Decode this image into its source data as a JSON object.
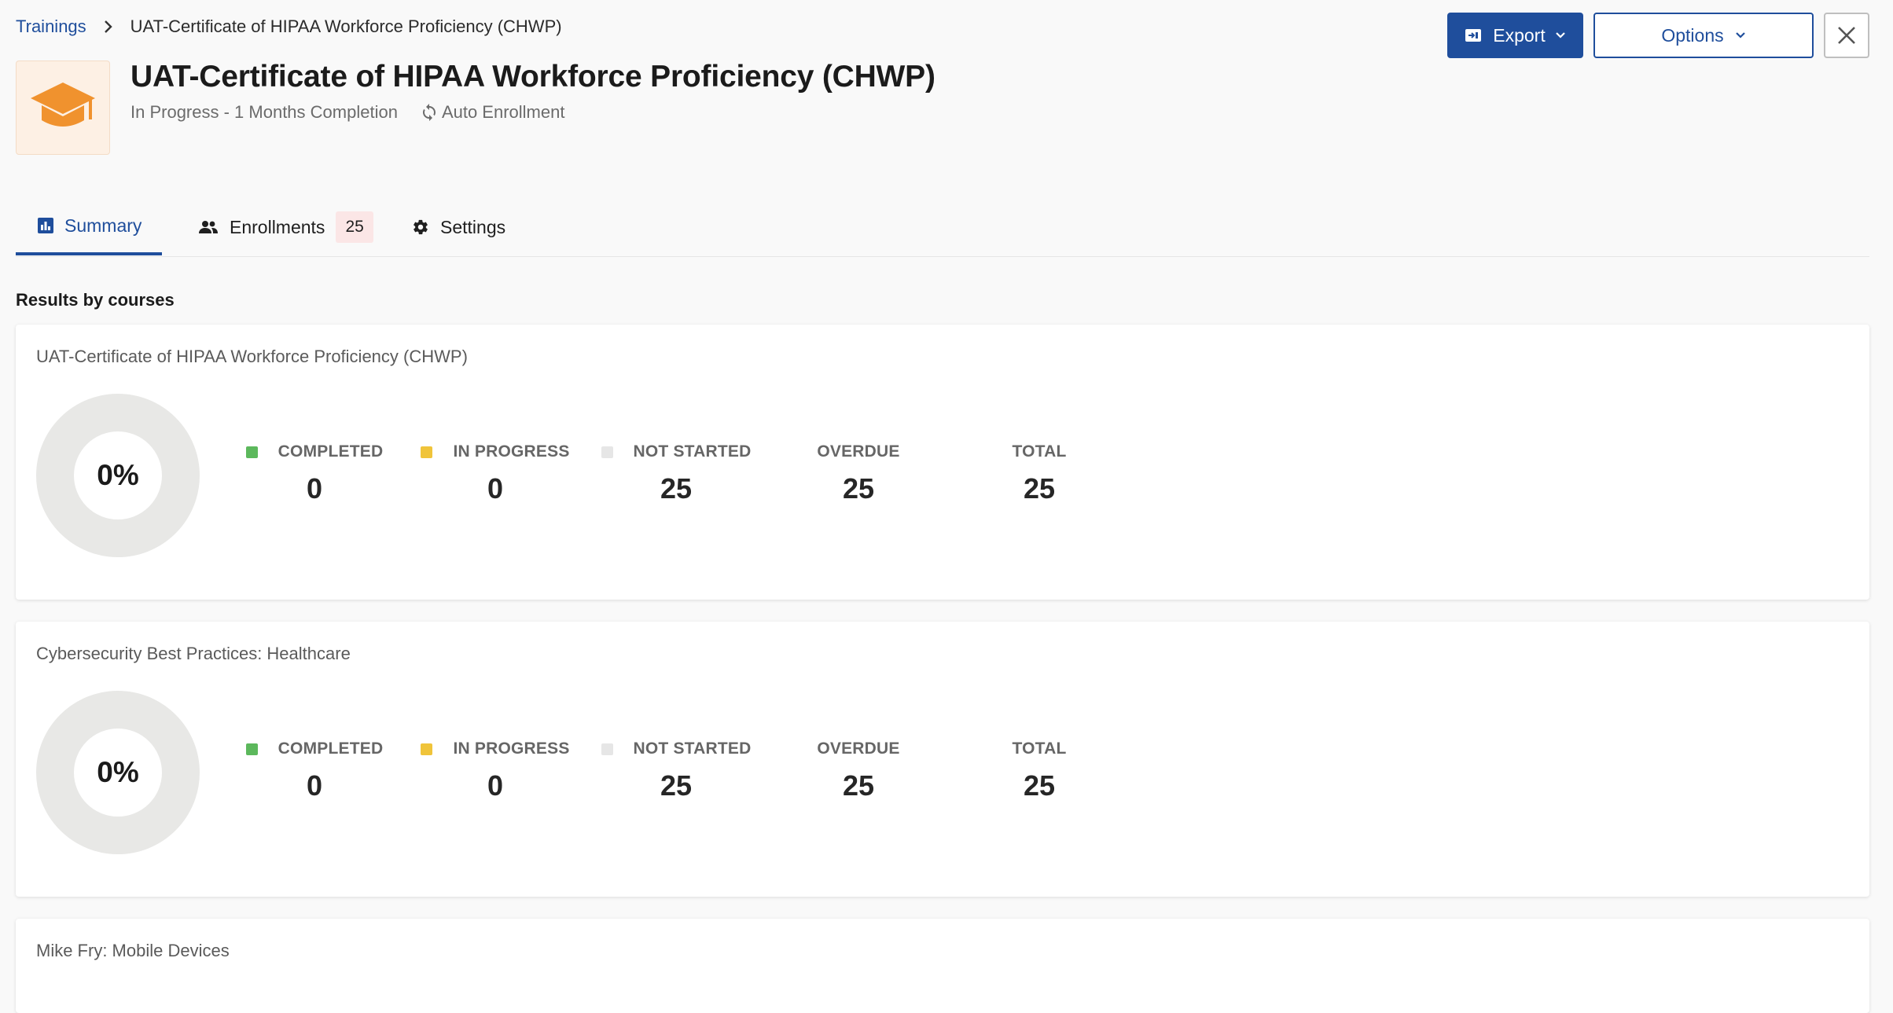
{
  "breadcrumb": {
    "parent": "Trainings",
    "current": "UAT-Certificate of HIPAA Workforce Proficiency (CHWP)"
  },
  "header": {
    "title": "UAT-Certificate of HIPAA Workforce Proficiency (CHWP)",
    "status": "In Progress - 1 Months Completion",
    "auto_enrollment": "Auto Enrollment",
    "icon": "graduation-cap-icon"
  },
  "actions": {
    "export_label": "Export",
    "options_label": "Options"
  },
  "tabs": [
    {
      "label": "Summary",
      "icon": "bar-chart-icon",
      "active": true
    },
    {
      "label": "Enrollments",
      "icon": "people-icon",
      "badge": "25"
    },
    {
      "label": "Settings",
      "icon": "gear-icon"
    }
  ],
  "section_title": "Results by courses",
  "stat_labels": {
    "completed": "COMPLETED",
    "in_progress": "IN PROGRESS",
    "not_started": "NOT STARTED",
    "overdue": "OVERDUE",
    "total": "TOTAL"
  },
  "courses": [
    {
      "title": "UAT-Certificate of HIPAA Workforce Proficiency (CHWP)",
      "percent": "0%",
      "completed": "0",
      "in_progress": "0",
      "not_started": "25",
      "overdue": "25",
      "total": "25"
    },
    {
      "title": "Cybersecurity Best Practices: Healthcare",
      "percent": "0%",
      "completed": "0",
      "in_progress": "0",
      "not_started": "25",
      "overdue": "25",
      "total": "25"
    },
    {
      "title": "Mike Fry: Mobile Devices"
    }
  ],
  "colors": {
    "primary": "#1f4e9c",
    "completed": "#5cb85c",
    "in_progress": "#f0c43a",
    "not_started": "#e6e6e6",
    "icon_orange": "#f0922e"
  }
}
